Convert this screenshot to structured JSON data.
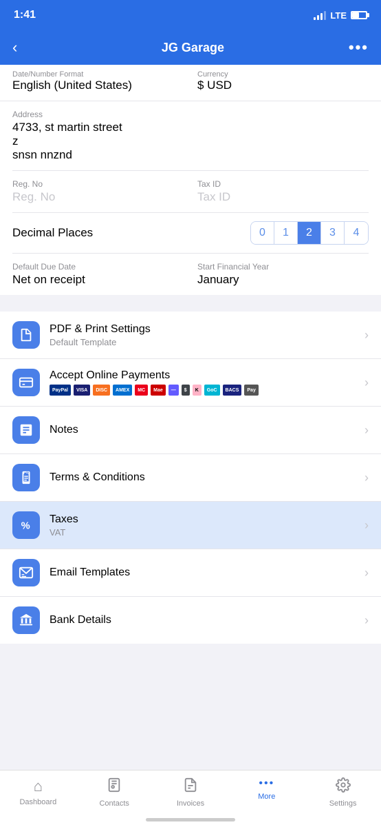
{
  "statusBar": {
    "time": "1:41",
    "lte": "LTE"
  },
  "navBar": {
    "title": "JG Garage",
    "backLabel": "‹",
    "moreLabel": "•••"
  },
  "form": {
    "partialLabel": "Date/Number Format",
    "currencyLabel": "Currency",
    "currencyValue": "$ USD",
    "localeValue": "English (United States)",
    "addressLabel": "Address",
    "addressLine1": "4733, st martin street",
    "addressLine2": "z",
    "addressLine3": "snsn nnznd",
    "regNoLabel": "Reg. No",
    "regNoPlaceholder": "Reg. No",
    "taxIdLabel": "Tax ID",
    "taxIdPlaceholder": "Tax ID",
    "decimalLabel": "Decimal Places",
    "decimalOptions": [
      "0",
      "1",
      "2",
      "3",
      "4"
    ],
    "selectedDecimal": 2,
    "defaultDueDateLabel": "Default Due Date",
    "defaultDueDateValue": "Net on receipt",
    "startFinancialYearLabel": "Start Financial Year",
    "startFinancialYearValue": "January"
  },
  "settingsItems": [
    {
      "id": "pdf-print",
      "title": "PDF & Print Settings",
      "subtitle": "Default Template",
      "icon": "document",
      "highlighted": false
    },
    {
      "id": "online-payments",
      "title": "Accept Online Payments",
      "subtitle": "payments",
      "icon": "card",
      "highlighted": false
    },
    {
      "id": "notes",
      "title": "Notes",
      "subtitle": "",
      "icon": "note",
      "highlighted": false
    },
    {
      "id": "terms",
      "title": "Terms & Conditions",
      "subtitle": "",
      "icon": "clipboard",
      "highlighted": false
    },
    {
      "id": "taxes",
      "title": "Taxes",
      "subtitle": "VAT",
      "icon": "percent",
      "highlighted": true
    },
    {
      "id": "email-templates",
      "title": "Email Templates",
      "subtitle": "",
      "icon": "email",
      "highlighted": false
    },
    {
      "id": "bank-details",
      "title": "Bank Details",
      "subtitle": "",
      "icon": "bank",
      "highlighted": false
    }
  ],
  "tabBar": {
    "items": [
      {
        "id": "dashboard",
        "label": "Dashboard",
        "icon": "🏠",
        "active": false
      },
      {
        "id": "contacts",
        "label": "Contacts",
        "icon": "👤",
        "active": false
      },
      {
        "id": "invoices",
        "label": "Invoices",
        "icon": "📄",
        "active": false
      },
      {
        "id": "more",
        "label": "More",
        "icon": "•••",
        "active": true
      },
      {
        "id": "settings",
        "label": "Settings",
        "icon": "⚙",
        "active": false
      }
    ]
  }
}
